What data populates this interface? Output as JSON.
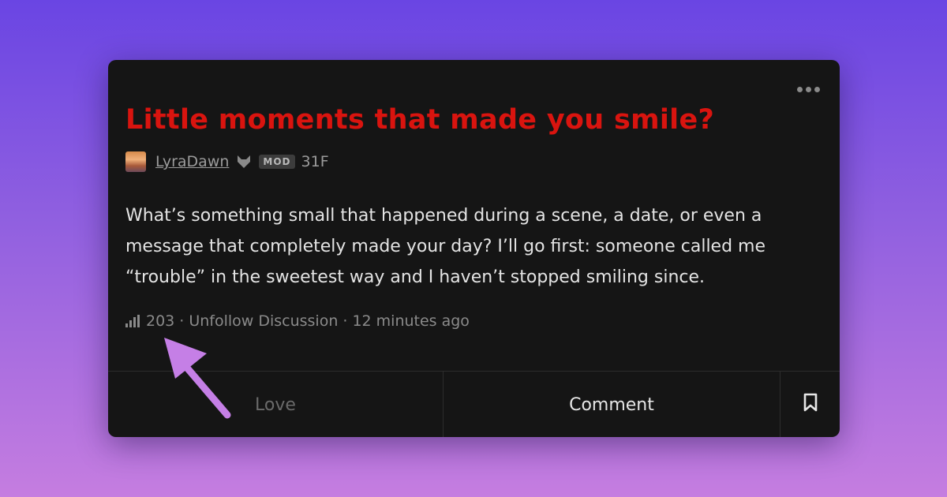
{
  "post": {
    "title": "Little moments that made you smile?",
    "author": {
      "username": "LyraDawn",
      "badge": "MOD",
      "age_gender": "31F",
      "badge_icon": "fox-icon"
    },
    "body": "What’s something small that happened during a scene, a date, or even a message that completely made your day? I’ll go first: someone called me “trouble” in the sweetest way and I haven’t stopped smiling since.",
    "stats": {
      "views": "203",
      "separator": "·",
      "follow_label": "Unfollow Discussion",
      "time_ago": "12 minutes ago"
    }
  },
  "actions": {
    "love_label": "Love",
    "comment_label": "Comment",
    "bookmark_icon": "bookmark-icon"
  },
  "colors": {
    "title": "#d9140f",
    "card_bg": "#151515",
    "arrow": "#c57fe6"
  }
}
